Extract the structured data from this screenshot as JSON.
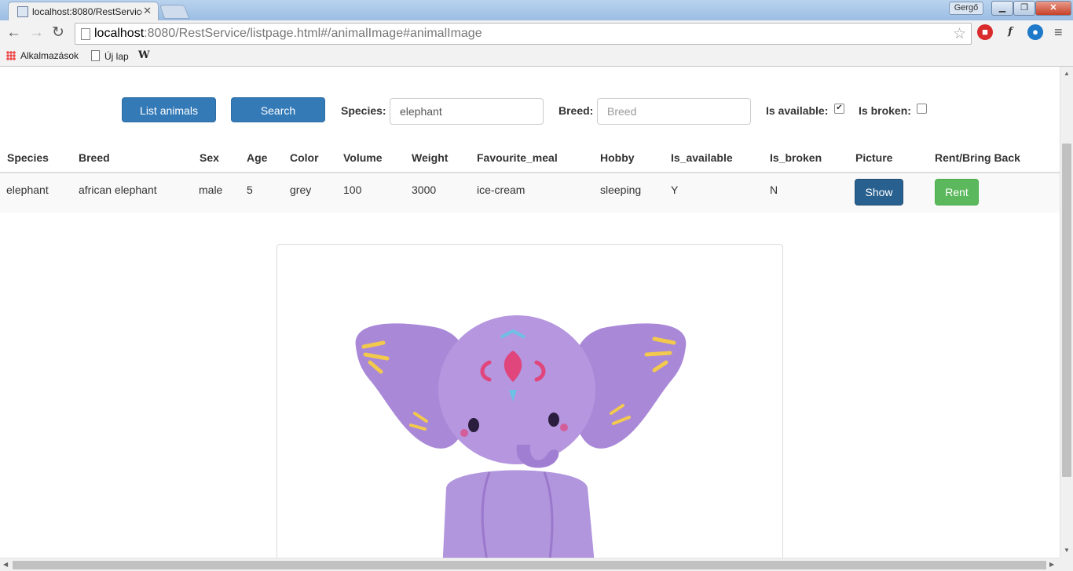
{
  "browser": {
    "tab_title": "localhost:8080/RestService",
    "url_host": "localhost",
    "url_rest": ":8080/RestService/listpage.html#/animalImage#animalImage",
    "user_name": "Gergő",
    "bookmarks": [
      "Alkalmazások",
      "Új lap",
      "W"
    ]
  },
  "controls": {
    "list_button": "List animals",
    "search_button": "Search",
    "species_label": "Species:",
    "species_value": "elephant",
    "breed_label": "Breed:",
    "breed_placeholder": "Breed",
    "available_label": "Is available:",
    "available_checked": true,
    "broken_label": "Is broken:",
    "broken_checked": false
  },
  "table": {
    "headers": [
      "Species",
      "Breed",
      "Sex",
      "Age",
      "Color",
      "Volume",
      "Weight",
      "Favourite_meal",
      "Hobby",
      "Is_available",
      "Is_broken",
      "Picture",
      "Rent/Bring Back"
    ],
    "rows": [
      {
        "species": "elephant",
        "breed": "african elephant",
        "sex": "male",
        "age": "5",
        "color": "grey",
        "volume": "100",
        "weight": "3000",
        "favourite_meal": "ice-cream",
        "hobby": "sleeping",
        "is_available": "Y",
        "is_broken": "N",
        "show_label": "Show",
        "rent_label": "Rent"
      }
    ]
  },
  "colors": {
    "primary": "#337ab7",
    "primary_dark": "#286090",
    "success": "#5cb85c",
    "plush_purple": "#a987d6"
  }
}
